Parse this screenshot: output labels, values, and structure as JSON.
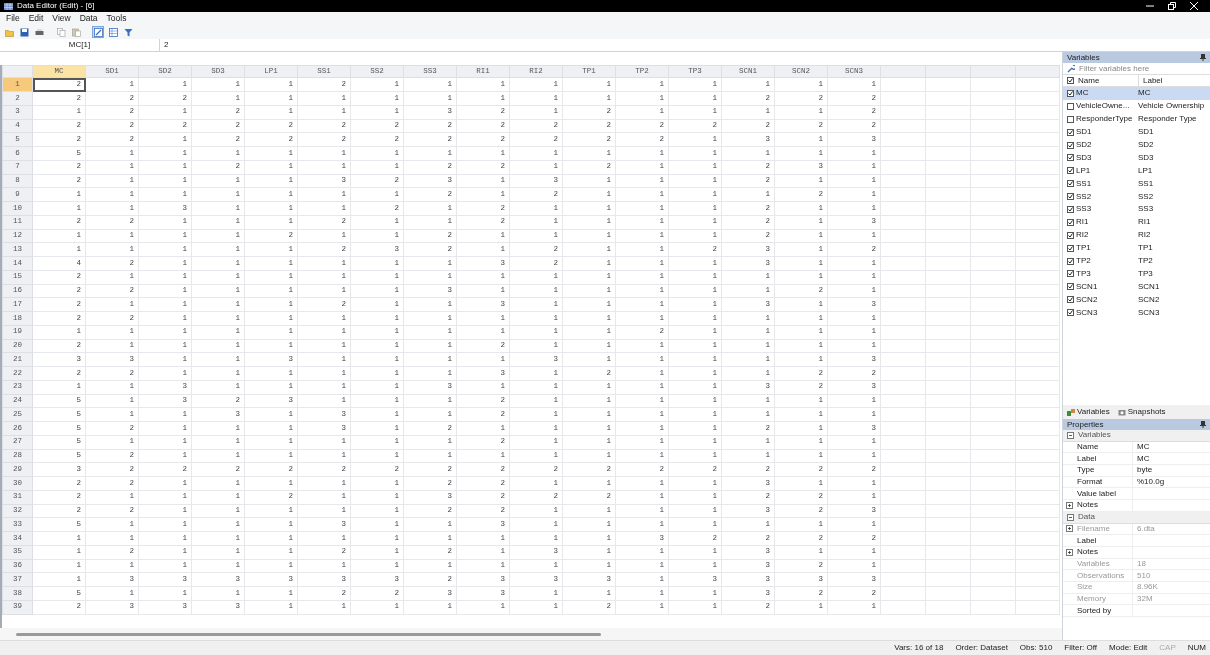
{
  "window": {
    "title": "Data Editor (Edit) - [6]"
  },
  "menu": [
    "File",
    "Edit",
    "View",
    "Data",
    "Tools"
  ],
  "toolbar": [
    {
      "kind": "open",
      "selected": false
    },
    {
      "kind": "save",
      "selected": false
    },
    {
      "kind": "print",
      "selected": false
    },
    {
      "kind": "copy",
      "selected": false
    },
    {
      "kind": "paste",
      "selected": false
    },
    {
      "kind": "edit",
      "selected": true
    },
    {
      "kind": "browse",
      "selected": false
    },
    {
      "kind": "filter",
      "selected": false
    }
  ],
  "cell_bar": {
    "reference": "MC[1]",
    "value": "2"
  },
  "grid": {
    "columns": [
      {
        "name": "MC",
        "selected": true
      },
      {
        "name": "SD1",
        "selected": false
      },
      {
        "name": "SD2",
        "selected": false
      },
      {
        "name": "SD3",
        "selected": false
      },
      {
        "name": "LP1",
        "selected": false
      },
      {
        "name": "SS1",
        "selected": false
      },
      {
        "name": "SS2",
        "selected": false
      },
      {
        "name": "SS3",
        "selected": false
      },
      {
        "name": "RI1",
        "selected": false
      },
      {
        "name": "RI2",
        "selected": false
      },
      {
        "name": "TP1",
        "selected": false
      },
      {
        "name": "TP2",
        "selected": false
      },
      {
        "name": "TP3",
        "selected": false
      },
      {
        "name": "SCN1",
        "selected": false
      },
      {
        "name": "SCN2",
        "selected": false
      },
      {
        "name": "SCN3",
        "selected": false
      }
    ],
    "rows": [
      {
        "number": "1",
        "selected": true,
        "values": [
          "2",
          "1",
          "1",
          "1",
          "1",
          "2",
          "1",
          "1",
          "1",
          "1",
          "1",
          "1",
          "1",
          "1",
          "1",
          "1"
        ]
      },
      {
        "number": "2",
        "selected": false,
        "values": [
          "2",
          "2",
          "2",
          "1",
          "1",
          "1",
          "1",
          "1",
          "1",
          "1",
          "1",
          "1",
          "1",
          "2",
          "2",
          "2"
        ]
      },
      {
        "number": "3",
        "selected": false,
        "values": [
          "1",
          "2",
          "1",
          "2",
          "1",
          "1",
          "1",
          "3",
          "2",
          "1",
          "2",
          "1",
          "1",
          "1",
          "1",
          "2"
        ]
      },
      {
        "number": "4",
        "selected": false,
        "values": [
          "2",
          "2",
          "2",
          "2",
          "2",
          "2",
          "2",
          "2",
          "2",
          "2",
          "2",
          "2",
          "2",
          "2",
          "2",
          "2"
        ]
      },
      {
        "number": "5",
        "selected": false,
        "values": [
          "2",
          "2",
          "1",
          "2",
          "2",
          "2",
          "2",
          "2",
          "2",
          "2",
          "2",
          "2",
          "1",
          "3",
          "1",
          "3"
        ]
      },
      {
        "number": "6",
        "selected": false,
        "values": [
          "5",
          "1",
          "1",
          "1",
          "1",
          "1",
          "1",
          "1",
          "1",
          "1",
          "1",
          "1",
          "1",
          "1",
          "1",
          "1"
        ]
      },
      {
        "number": "7",
        "selected": false,
        "values": [
          "2",
          "1",
          "1",
          "2",
          "1",
          "1",
          "1",
          "2",
          "2",
          "1",
          "2",
          "1",
          "1",
          "2",
          "3",
          "1"
        ]
      },
      {
        "number": "8",
        "selected": false,
        "values": [
          "2",
          "1",
          "1",
          "1",
          "1",
          "3",
          "2",
          "3",
          "1",
          "3",
          "1",
          "1",
          "1",
          "2",
          "1",
          "1"
        ]
      },
      {
        "number": "9",
        "selected": false,
        "values": [
          "1",
          "1",
          "1",
          "1",
          "1",
          "1",
          "1",
          "2",
          "1",
          "2",
          "1",
          "1",
          "1",
          "1",
          "2",
          "1"
        ]
      },
      {
        "number": "10",
        "selected": false,
        "values": [
          "1",
          "1",
          "3",
          "1",
          "1",
          "1",
          "2",
          "1",
          "2",
          "1",
          "1",
          "1",
          "1",
          "2",
          "1",
          "1"
        ]
      },
      {
        "number": "11",
        "selected": false,
        "values": [
          "2",
          "2",
          "1",
          "1",
          "1",
          "2",
          "1",
          "1",
          "2",
          "1",
          "1",
          "1",
          "1",
          "2",
          "1",
          "3"
        ]
      },
      {
        "number": "12",
        "selected": false,
        "values": [
          "1",
          "1",
          "1",
          "1",
          "2",
          "1",
          "1",
          "2",
          "1",
          "1",
          "1",
          "1",
          "1",
          "2",
          "1",
          "1"
        ]
      },
      {
        "number": "13",
        "selected": false,
        "values": [
          "1",
          "1",
          "1",
          "1",
          "1",
          "2",
          "3",
          "2",
          "1",
          "2",
          "1",
          "1",
          "2",
          "3",
          "1",
          "2"
        ]
      },
      {
        "number": "14",
        "selected": false,
        "values": [
          "4",
          "2",
          "1",
          "1",
          "1",
          "1",
          "1",
          "1",
          "3",
          "2",
          "1",
          "1",
          "1",
          "3",
          "1",
          "1"
        ]
      },
      {
        "number": "15",
        "selected": false,
        "values": [
          "2",
          "1",
          "1",
          "1",
          "1",
          "1",
          "1",
          "1",
          "1",
          "1",
          "1",
          "1",
          "1",
          "1",
          "1",
          "1"
        ]
      },
      {
        "number": "16",
        "selected": false,
        "values": [
          "2",
          "2",
          "1",
          "1",
          "1",
          "1",
          "1",
          "3",
          "1",
          "1",
          "1",
          "1",
          "1",
          "1",
          "2",
          "1"
        ]
      },
      {
        "number": "17",
        "selected": false,
        "values": [
          "2",
          "1",
          "1",
          "1",
          "1",
          "2",
          "1",
          "1",
          "3",
          "1",
          "1",
          "1",
          "1",
          "3",
          "1",
          "3"
        ]
      },
      {
        "number": "18",
        "selected": false,
        "values": [
          "2",
          "2",
          "1",
          "1",
          "1",
          "1",
          "1",
          "1",
          "1",
          "1",
          "1",
          "1",
          "1",
          "1",
          "1",
          "1"
        ]
      },
      {
        "number": "19",
        "selected": false,
        "values": [
          "1",
          "1",
          "1",
          "1",
          "1",
          "1",
          "1",
          "1",
          "1",
          "1",
          "1",
          "2",
          "1",
          "1",
          "1",
          "1"
        ]
      },
      {
        "number": "20",
        "selected": false,
        "values": [
          "2",
          "1",
          "1",
          "1",
          "1",
          "1",
          "1",
          "1",
          "2",
          "1",
          "1",
          "1",
          "1",
          "1",
          "1",
          "1"
        ]
      },
      {
        "number": "21",
        "selected": false,
        "values": [
          "3",
          "3",
          "1",
          "1",
          "3",
          "1",
          "1",
          "1",
          "1",
          "3",
          "1",
          "1",
          "1",
          "1",
          "1",
          "3"
        ]
      },
      {
        "number": "22",
        "selected": false,
        "values": [
          "2",
          "2",
          "1",
          "1",
          "1",
          "1",
          "1",
          "1",
          "3",
          "1",
          "2",
          "1",
          "1",
          "1",
          "2",
          "2"
        ]
      },
      {
        "number": "23",
        "selected": false,
        "values": [
          "1",
          "1",
          "3",
          "1",
          "1",
          "1",
          "1",
          "3",
          "1",
          "1",
          "1",
          "1",
          "1",
          "3",
          "2",
          "3"
        ]
      },
      {
        "number": "24",
        "selected": false,
        "values": [
          "5",
          "1",
          "3",
          "2",
          "3",
          "1",
          "1",
          "1",
          "2",
          "1",
          "1",
          "1",
          "1",
          "1",
          "1",
          "1"
        ]
      },
      {
        "number": "25",
        "selected": false,
        "values": [
          "5",
          "1",
          "1",
          "3",
          "1",
          "3",
          "1",
          "1",
          "2",
          "1",
          "1",
          "1",
          "1",
          "1",
          "1",
          "1"
        ]
      },
      {
        "number": "26",
        "selected": false,
        "values": [
          "5",
          "2",
          "1",
          "1",
          "1",
          "3",
          "1",
          "2",
          "1",
          "1",
          "1",
          "1",
          "1",
          "2",
          "1",
          "3"
        ]
      },
      {
        "number": "27",
        "selected": false,
        "values": [
          "5",
          "1",
          "1",
          "1",
          "1",
          "1",
          "1",
          "1",
          "2",
          "1",
          "1",
          "1",
          "1",
          "1",
          "1",
          "1"
        ]
      },
      {
        "number": "28",
        "selected": false,
        "values": [
          "5",
          "2",
          "1",
          "1",
          "1",
          "1",
          "1",
          "1",
          "1",
          "1",
          "1",
          "1",
          "1",
          "1",
          "1",
          "1"
        ]
      },
      {
        "number": "29",
        "selected": false,
        "values": [
          "3",
          "2",
          "2",
          "2",
          "2",
          "2",
          "2",
          "2",
          "2",
          "2",
          "2",
          "2",
          "2",
          "2",
          "2",
          "2"
        ]
      },
      {
        "number": "30",
        "selected": false,
        "values": [
          "2",
          "2",
          "1",
          "1",
          "1",
          "1",
          "1",
          "2",
          "2",
          "1",
          "1",
          "1",
          "1",
          "3",
          "1",
          "1"
        ]
      },
      {
        "number": "31",
        "selected": false,
        "values": [
          "2",
          "1",
          "1",
          "1",
          "2",
          "1",
          "1",
          "3",
          "2",
          "2",
          "2",
          "1",
          "1",
          "2",
          "2",
          "1"
        ]
      },
      {
        "number": "32",
        "selected": false,
        "values": [
          "2",
          "2",
          "1",
          "1",
          "1",
          "1",
          "1",
          "2",
          "2",
          "1",
          "1",
          "1",
          "1",
          "3",
          "2",
          "3"
        ]
      },
      {
        "number": "33",
        "selected": false,
        "values": [
          "5",
          "1",
          "1",
          "1",
          "1",
          "3",
          "1",
          "1",
          "3",
          "1",
          "1",
          "1",
          "1",
          "1",
          "1",
          "1"
        ]
      },
      {
        "number": "34",
        "selected": false,
        "values": [
          "1",
          "1",
          "1",
          "1",
          "1",
          "1",
          "1",
          "1",
          "1",
          "1",
          "1",
          "3",
          "2",
          "2",
          "2",
          "2"
        ]
      },
      {
        "number": "35",
        "selected": false,
        "values": [
          "1",
          "2",
          "1",
          "1",
          "1",
          "2",
          "1",
          "2",
          "1",
          "3",
          "1",
          "1",
          "1",
          "3",
          "1",
          "1"
        ]
      },
      {
        "number": "36",
        "selected": false,
        "values": [
          "1",
          "1",
          "1",
          "1",
          "1",
          "1",
          "1",
          "1",
          "1",
          "1",
          "1",
          "1",
          "1",
          "3",
          "2",
          "1"
        ]
      },
      {
        "number": "37",
        "selected": false,
        "values": [
          "1",
          "3",
          "3",
          "3",
          "3",
          "3",
          "3",
          "2",
          "3",
          "3",
          "3",
          "1",
          "3",
          "3",
          "3",
          "3"
        ]
      },
      {
        "number": "38",
        "selected": false,
        "values": [
          "5",
          "1",
          "1",
          "1",
          "1",
          "2",
          "2",
          "3",
          "3",
          "1",
          "1",
          "1",
          "1",
          "3",
          "2",
          "2"
        ]
      },
      {
        "number": "39",
        "selected": false,
        "values": [
          "2",
          "3",
          "3",
          "3",
          "1",
          "1",
          "1",
          "1",
          "1",
          "1",
          "2",
          "1",
          "1",
          "2",
          "1",
          "1"
        ]
      }
    ]
  },
  "variables_panel": {
    "title": "Variables",
    "filter_placeholder": "Filter variables here",
    "header": {
      "checked": true,
      "name": "Name",
      "label": "Label"
    },
    "items": [
      {
        "name": "MC",
        "label": "MC",
        "checked": true,
        "selected": true
      },
      {
        "name": "VehicleOwne...",
        "label": "Vehicle Ownership",
        "checked": false,
        "selected": false
      },
      {
        "name": "ResponderType",
        "label": "Responder Type",
        "checked": false,
        "selected": false
      },
      {
        "name": "SD1",
        "label": "SD1",
        "checked": true,
        "selected": false
      },
      {
        "name": "SD2",
        "label": "SD2",
        "checked": true,
        "selected": false
      },
      {
        "name": "SD3",
        "label": "SD3",
        "checked": true,
        "selected": false
      },
      {
        "name": "LP1",
        "label": "LP1",
        "checked": true,
        "selected": false
      },
      {
        "name": "SS1",
        "label": "SS1",
        "checked": true,
        "selected": false
      },
      {
        "name": "SS2",
        "label": "SS2",
        "checked": true,
        "selected": false
      },
      {
        "name": "SS3",
        "label": "SS3",
        "checked": true,
        "selected": false
      },
      {
        "name": "RI1",
        "label": "RI1",
        "checked": true,
        "selected": false
      },
      {
        "name": "RI2",
        "label": "RI2",
        "checked": true,
        "selected": false
      },
      {
        "name": "TP1",
        "label": "TP1",
        "checked": true,
        "selected": false
      },
      {
        "name": "TP2",
        "label": "TP2",
        "checked": true,
        "selected": false
      },
      {
        "name": "TP3",
        "label": "TP3",
        "checked": true,
        "selected": false
      },
      {
        "name": "SCN1",
        "label": "SCN1",
        "checked": true,
        "selected": false
      },
      {
        "name": "SCN2",
        "label": "SCN2",
        "checked": true,
        "selected": false
      },
      {
        "name": "SCN3",
        "label": "SCN3",
        "checked": true,
        "selected": false
      }
    ]
  },
  "panel_tabs": [
    {
      "kind": "variables",
      "label": "Variables"
    },
    {
      "kind": "snapshots",
      "label": "Snapshots"
    }
  ],
  "properties": {
    "title": "Properties",
    "sections": [
      {
        "title": "Variables",
        "expanded": true,
        "rows": [
          {
            "name": "Name",
            "value": "MC",
            "disabled": false,
            "expandable": false
          },
          {
            "name": "Label",
            "value": "MC",
            "disabled": false,
            "expandable": false
          },
          {
            "name": "Type",
            "value": "byte",
            "disabled": false,
            "expandable": false
          },
          {
            "name": "Format",
            "value": "%10.0g",
            "disabled": false,
            "expandable": false
          },
          {
            "name": "Value label",
            "disabled": false,
            "expandable": false
          },
          {
            "name": "Notes",
            "disabled": false,
            "expandable": true
          }
        ]
      },
      {
        "title": "Data",
        "expanded": true,
        "rows": [
          {
            "name": "Filename",
            "value": "6.dta",
            "disabled": true,
            "expandable": true
          },
          {
            "name": "Label",
            "disabled": false,
            "expandable": false
          },
          {
            "name": "Notes",
            "disabled": false,
            "expandable": true
          },
          {
            "name": "Variables",
            "value": "18",
            "disabled": true,
            "expandable": false
          },
          {
            "name": "Observations",
            "value": "510",
            "disabled": true,
            "expandable": false
          },
          {
            "name": "Size",
            "value": "8.96K",
            "disabled": true,
            "expandable": false
          },
          {
            "name": "Memory",
            "value": "32M",
            "disabled": true,
            "expandable": false
          },
          {
            "name": "Sorted by",
            "disabled": false,
            "expandable": false
          }
        ]
      }
    ]
  },
  "status_bar": [
    {
      "text": "Vars: 16 of 18",
      "disabled": false
    },
    {
      "text": "Order: Dataset",
      "disabled": false
    },
    {
      "text": "Obs: 510",
      "disabled": false
    },
    {
      "text": "Filter: Off",
      "disabled": false
    },
    {
      "text": "Mode: Edit",
      "disabled": false
    },
    {
      "text": "CAP",
      "disabled": true
    },
    {
      "text": "NUM",
      "disabled": false
    }
  ]
}
